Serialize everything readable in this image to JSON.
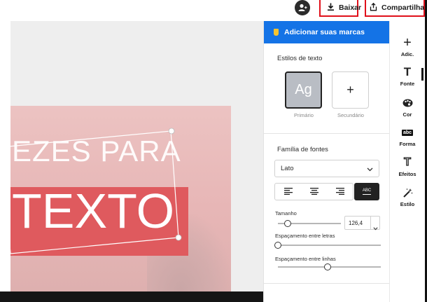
{
  "topbar": {
    "avatar_icon": "person-add-icon",
    "download_icon": "download-icon",
    "download_label": "Baixar",
    "share_icon": "share-icon",
    "share_label": "Compartilhar"
  },
  "canvas": {
    "line1": "EZES PARA",
    "line2": "TEXTO",
    "accent_color": "#df5a5e",
    "background_color": "#e8b8b8"
  },
  "panel": {
    "header_label": "Adicionar suas marcas",
    "header_color": "#1473e6",
    "text_styles_title": "Estilos de texto",
    "primary_card_text": "Ag",
    "primary_card_label": "Primário",
    "secondary_card_text": "+",
    "secondary_card_label": "Secundário",
    "font_family_title": "Família de fontes",
    "font_selected": "Lato",
    "case_button_text": "ABC",
    "size_label": "Tamanho",
    "size_value": "126,4",
    "size_slider_pct": 16,
    "letter_spacing_label": "Espaçamento entre letras",
    "letter_spacing_pct": 0,
    "line_spacing_label": "Espaçamento entre linhas",
    "line_spacing_pct": 48
  },
  "toolbar": {
    "items": [
      {
        "label": "Adic.",
        "icon": "plus-icon",
        "glyph": "+"
      },
      {
        "label": "Fonte",
        "icon": "text-icon",
        "glyph": "T"
      },
      {
        "label": "Cor",
        "icon": "palette-icon",
        "glyph": ""
      },
      {
        "label": "Forma",
        "icon": "shape-abc-icon",
        "glyph": "abc"
      },
      {
        "label": "Efeitos",
        "icon": "effects-icon",
        "glyph": "T"
      },
      {
        "label": "Estilo",
        "icon": "magic-wand-icon",
        "glyph": ""
      }
    ]
  }
}
